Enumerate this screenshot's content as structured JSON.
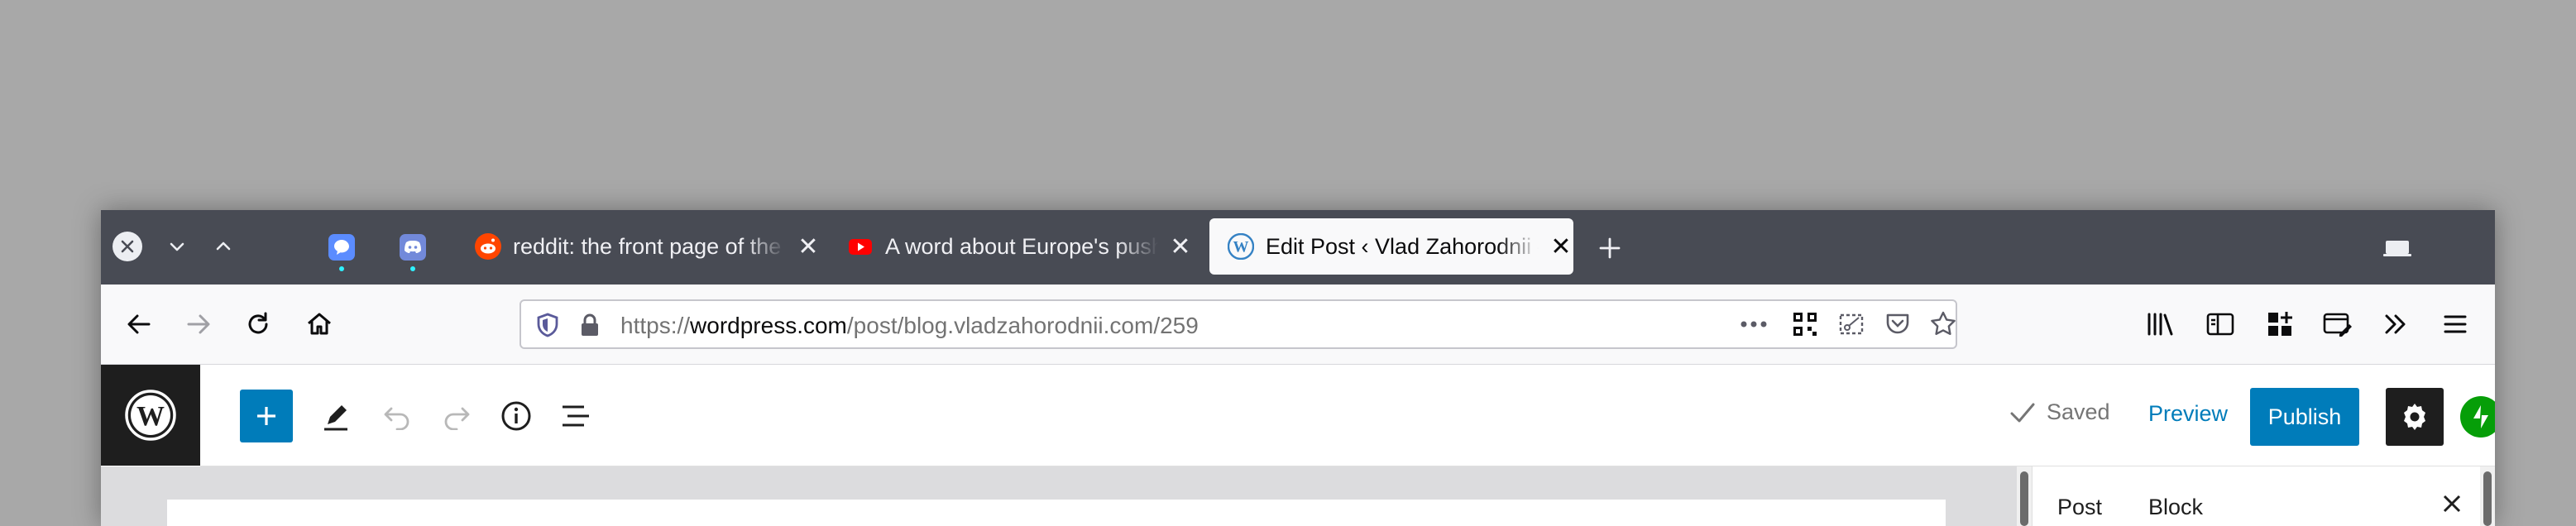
{
  "browser": {
    "tabs": [
      {
        "title": "reddit: the front page of the internet",
        "favicon": "reddit-icon",
        "color": "#ff4500"
      },
      {
        "title": "A word about Europe's push",
        "favicon": "youtube-icon",
        "color": "#ff0000"
      },
      {
        "title": "Edit Post ‹ Vlad Zahorodnii — WordPress.com",
        "favicon": "wordpress-icon",
        "color": "#3582c4",
        "active": true
      }
    ],
    "pinned_tabs": [
      {
        "favicon": "chat-bubble-icon",
        "color": "#5b8cff"
      },
      {
        "favicon": "discord-icon",
        "color": "#7289da"
      }
    ],
    "url": {
      "scheme": "https://",
      "domain": "wordpress.com",
      "path": "/post/blog.vladzahorodnii.com/259"
    }
  },
  "editor": {
    "status": "Saved",
    "preview_label": "Preview",
    "publish_label": "Publish",
    "accent": "#007cba",
    "sidebar": {
      "tab_post": "Post",
      "tab_block": "Block"
    }
  }
}
